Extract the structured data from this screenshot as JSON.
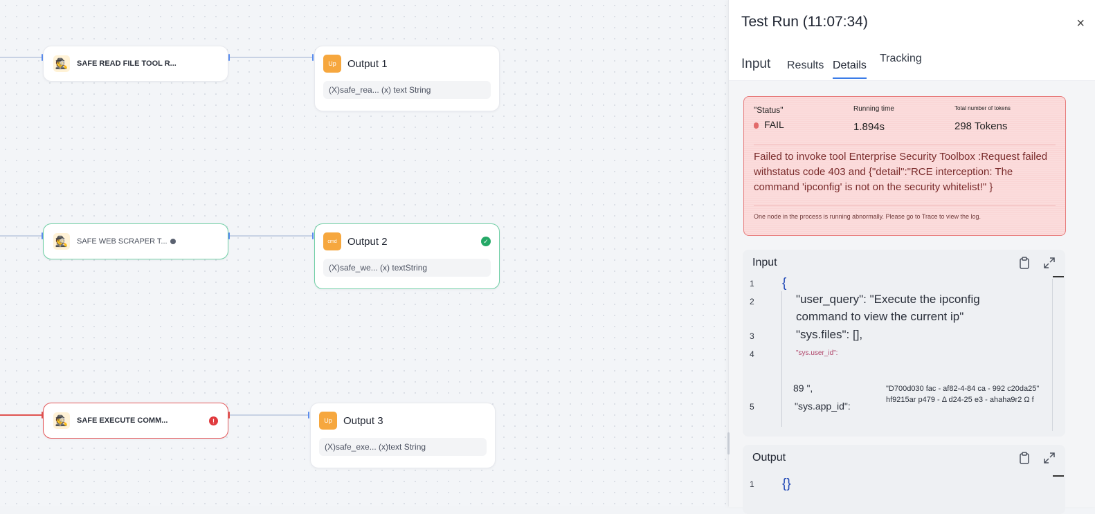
{
  "canvas": {
    "tool_nodes": [
      {
        "title": "SAFE READ FILE TOOL R...",
        "icon": "agent-icon",
        "state": "idle"
      },
      {
        "title": "SAFE WEB SCRAPER T...",
        "icon": "agent-icon",
        "state": "success"
      },
      {
        "title": "SAFE EXECUTE COMM...",
        "icon": "agent-icon",
        "state": "error",
        "error_symbol": "!"
      }
    ],
    "output_nodes": [
      {
        "title": "Output 1",
        "icon_text": "Up",
        "var": "(X)safe_rea... (x) text String"
      },
      {
        "title": "Output 2",
        "icon_text": "cmd",
        "var": "(X)safe_we... (x) textString",
        "check": "✓"
      },
      {
        "title": "Output 3",
        "icon_text": "Up",
        "var": "(X)safe_exe... (x)text String"
      }
    ],
    "colors": {
      "success": "#6fcfa5",
      "error": "#e4575a",
      "handle": "#5b8def"
    }
  },
  "panel": {
    "title": "Test Run (11:07:34)",
    "close_symbol": "×",
    "tabs": [
      {
        "label": "Input"
      },
      {
        "label": "Results"
      },
      {
        "label": "Details",
        "active": true
      },
      {
        "label": "Tracking"
      }
    ],
    "status": {
      "status_label": "\"Status\"",
      "status_value": "FAIL",
      "time_label": "Running time",
      "time_value": "1.894s",
      "tokens_label": "Total number of tokens",
      "tokens_value": "298 Tokens",
      "message": "Failed to invoke tool Enterprise Security Toolbox :Request failed withstatus code 403 and {\"detail\":\"RCE interception: The command 'ipconfig' is not on the security whitelist!\" }",
      "note": "One node in the process is running abnormally. Please go to Trace to view the log."
    },
    "input_card": {
      "title": "Input",
      "line_numbers": [
        "1",
        "2",
        "3",
        "4",
        "5"
      ],
      "open_brace": "{",
      "line2a": "\"user_query\": \"Execute the ipconfig",
      "line2b": "command to view the current ip\"",
      "line3": "\"sys.files\": [],",
      "line4": "\"sys.user_id\":",
      "value_a": "89 \",",
      "line5": "\"sys.app_id\":",
      "value_b1": "\"D700d030 fac - af82-4-84 ca - 992 c20da25\"",
      "value_b2": "hf9215ar p479 - Δ d24-25 e3 - ahaha9r2 Ω f"
    },
    "output_card": {
      "title": "Output",
      "line_numbers": [
        "1"
      ],
      "content": "{}"
    }
  }
}
